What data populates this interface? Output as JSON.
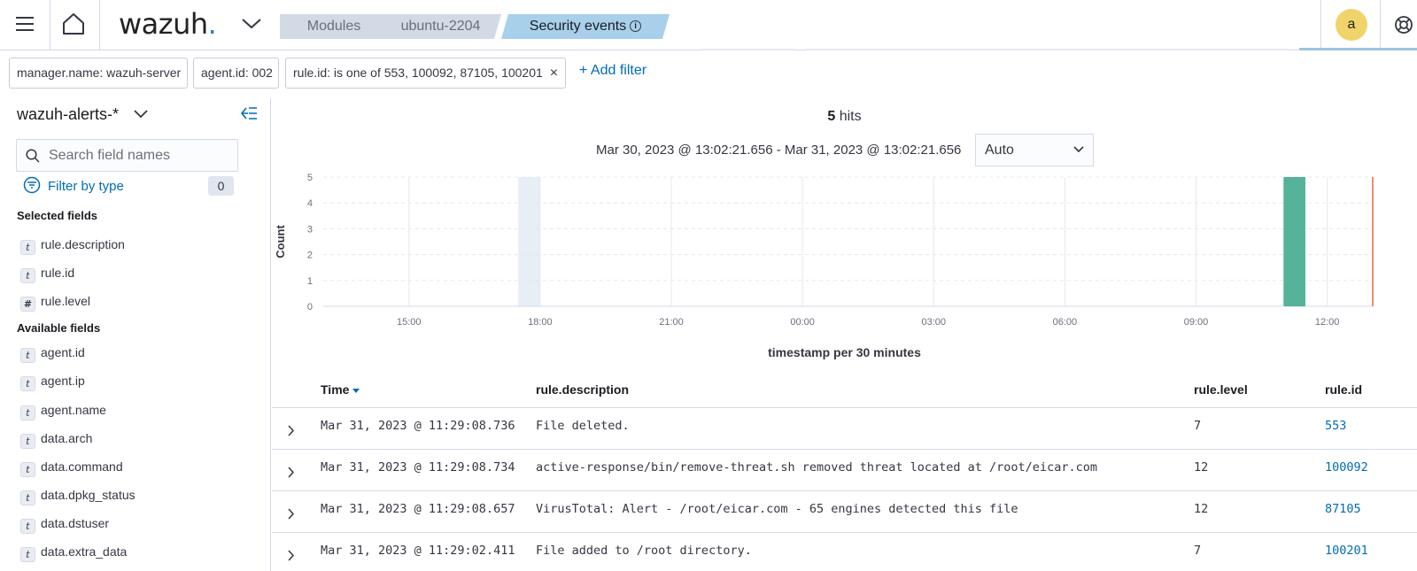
{
  "header": {
    "logo_text": "wazuh",
    "logo_dot": ".",
    "breadcrumbs": [
      "Modules",
      "ubuntu-2204",
      "Security events"
    ],
    "avatar_initial": "a"
  },
  "filters": {
    "pills": [
      "manager.name: wazuh-server",
      "agent.id: 002",
      "rule.id: is one of 553, 100092, 87105, 100201"
    ],
    "remove_glyph": "×",
    "add_label": "+ Add filter"
  },
  "sidebar": {
    "index_pattern": "wazuh-alerts-*",
    "search_placeholder": "Search field names",
    "filter_by_type_label": "Filter by type",
    "filter_count": "0",
    "selected_title": "Selected fields",
    "selected_fields": [
      {
        "type": "t",
        "name": "rule.description"
      },
      {
        "type": "t",
        "name": "rule.id"
      },
      {
        "type": "#",
        "name": "rule.level"
      }
    ],
    "available_title": "Available fields",
    "available_fields": [
      {
        "type": "t",
        "name": "agent.id"
      },
      {
        "type": "t",
        "name": "agent.ip"
      },
      {
        "type": "t",
        "name": "agent.name"
      },
      {
        "type": "t",
        "name": "data.arch"
      },
      {
        "type": "t",
        "name": "data.command"
      },
      {
        "type": "t",
        "name": "data.dpkg_status"
      },
      {
        "type": "t",
        "name": "data.dstuser"
      },
      {
        "type": "t",
        "name": "data.extra_data"
      }
    ]
  },
  "histogram": {
    "hits_count": "5",
    "hits_label": "hits",
    "date_range": "Mar 30, 2023 @ 13:02:21.656 - Mar 31, 2023 @ 13:02:21.656",
    "interval": "Auto"
  },
  "chart_data": {
    "type": "bar",
    "title": "",
    "xlabel": "timestamp per 30 minutes",
    "ylabel": "Count",
    "ylim": [
      0,
      5
    ],
    "y_ticks": [
      "0",
      "1",
      "2",
      "3",
      "4",
      "5"
    ],
    "x_ticks": [
      "15:00",
      "18:00",
      "21:00",
      "00:00",
      "03:00",
      "06:00",
      "09:00",
      "12:00"
    ],
    "x_range_hours": [
      13.04,
      37.04
    ],
    "x_tick_hours": [
      15,
      18,
      21,
      24,
      27,
      30,
      33,
      36
    ],
    "bars": [
      {
        "start_hour": 35.0,
        "end_hour": 35.5,
        "value": 5
      }
    ],
    "highlight_band_hours": [
      17.5,
      18.0
    ],
    "now_marker_hour": 37.04,
    "colors": {
      "bar": "#54b399",
      "now_line": "#e7664c",
      "band": "#e8eef6",
      "grid": "#e4e8ef"
    },
    "grid": true
  },
  "table": {
    "columns": [
      "Time",
      "rule.description",
      "rule.level",
      "rule.id"
    ],
    "rows": [
      {
        "time": "Mar 31, 2023 @ 11:29:08.736",
        "description": "File deleted.",
        "level": "7",
        "id": "553"
      },
      {
        "time": "Mar 31, 2023 @ 11:29:08.734",
        "description": "active-response/bin/remove-threat.sh removed threat located at /root/eicar.com",
        "level": "12",
        "id": "100092"
      },
      {
        "time": "Mar 31, 2023 @ 11:29:08.657",
        "description": "VirusTotal: Alert - /root/eicar.com - 65 engines detected this file",
        "level": "12",
        "id": "87105"
      },
      {
        "time": "Mar 31, 2023 @ 11:29:02.411",
        "description": "File added to /root directory.",
        "level": "7",
        "id": "100201"
      }
    ]
  }
}
